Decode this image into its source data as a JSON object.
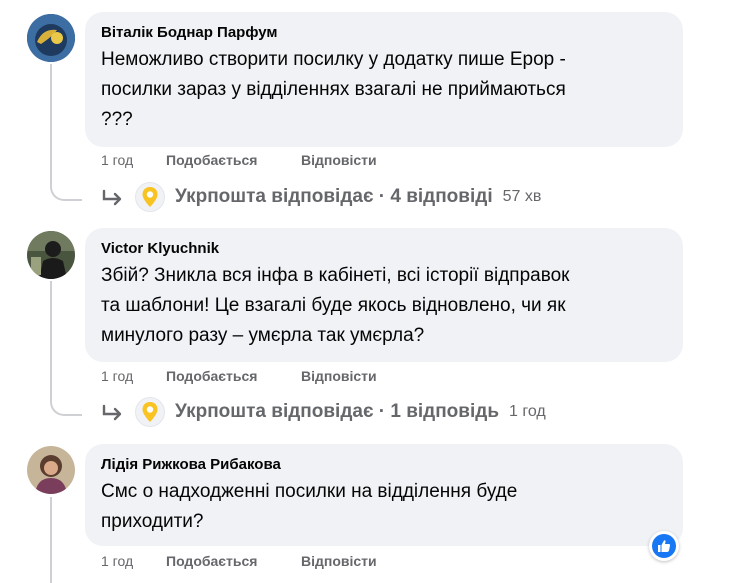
{
  "comments": [
    {
      "author": "Віталік Боднар Парфум",
      "text_lines": [
        "Неможливо створити посилку у додатку пише Ерор -",
        "посилки зараз у відділеннях взагалі не приймаються",
        "???"
      ],
      "time": "1 год",
      "like": "Подобається",
      "reply": "Відповісти",
      "replies_summary": "Укрпошта відповідає · 4 відповіді",
      "replies_ago": "57 хв"
    },
    {
      "author": "Victor Klyuchnik",
      "text_lines": [
        "Збій? Зникла вся інфа в кабінеті, всі історії відправок",
        "та шаблони! Це взагалі буде якось відновлено, чи як",
        "минулого разу – умєрла так умєрла?"
      ],
      "time": "1 год",
      "like": "Подобається",
      "reply": "Відповісти",
      "replies_summary": "Укрпошта відповідає · 1 відповідь",
      "replies_ago": "1 год"
    },
    {
      "author": "Лідія Рижкова Рибакова",
      "text_lines": [
        "Смс о надходженні посилки на відділення буде",
        "приходити?"
      ],
      "time": "1 год",
      "like": "Подобається",
      "reply": "Відповісти"
    }
  ],
  "icons": {
    "reply_arrow": "reply-arrow-icon",
    "ukrposhta_logo": "ukrposhta-logo-icon",
    "like_reaction": "like-reaction-icon"
  },
  "colors": {
    "bubble": "#f0f2f5",
    "muted_text": "#65676b",
    "ukrposhta_yellow": "#f9c322",
    "like_blue": "#1877f2"
  }
}
